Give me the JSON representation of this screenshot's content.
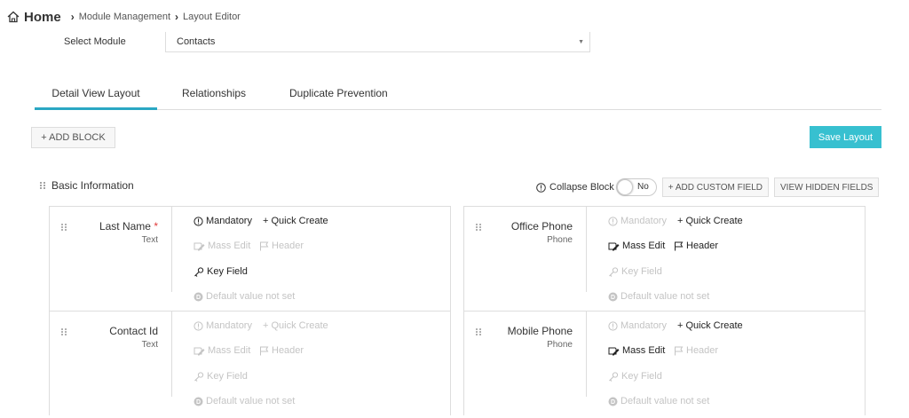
{
  "breadcrumb": {
    "home": "Home",
    "items": [
      "Module Management",
      "Layout Editor"
    ]
  },
  "module_select": {
    "label": "Select Module",
    "value": "Contacts"
  },
  "tabs": [
    "Detail View Layout",
    "Relationships",
    "Duplicate Prevention"
  ],
  "toolbar": {
    "add_block": "+ ADD BLOCK",
    "save_layout": "Save Layout"
  },
  "block": {
    "title": "Basic Information",
    "collapse_label": "Collapse Block",
    "toggle_value": "No",
    "add_custom_field": "+ ADD CUSTOM FIELD",
    "view_hidden_fields": "VIEW HIDDEN FIELDS"
  },
  "property_labels": {
    "mandatory": "Mandatory",
    "quick_create": "+ Quick Create",
    "mass_edit": "Mass Edit",
    "header": "Header",
    "key_field": "Key Field",
    "default_value": "Default value not set"
  },
  "fields": [
    {
      "name": "Last Name",
      "required_mark": "*",
      "type": "Text",
      "mandatory": true,
      "quick_create": true,
      "mass_edit": false,
      "header": false,
      "key_field": true
    },
    {
      "name": "Office Phone",
      "required_mark": "",
      "type": "Phone",
      "mandatory": false,
      "quick_create": true,
      "mass_edit": true,
      "header": true,
      "key_field": false
    },
    {
      "name": "Contact Id",
      "required_mark": "",
      "type": "Text",
      "mandatory": false,
      "quick_create": false,
      "mass_edit": false,
      "header": false,
      "key_field": false
    },
    {
      "name": "Mobile Phone",
      "required_mark": "",
      "type": "Phone",
      "mandatory": false,
      "quick_create": true,
      "mass_edit": true,
      "header": false,
      "key_field": false
    }
  ],
  "colors": {
    "accent": "#2aa7c3",
    "save_button": "#37c0d0",
    "required": "#e03a3a",
    "disabled_text": "#c4c4c4"
  }
}
